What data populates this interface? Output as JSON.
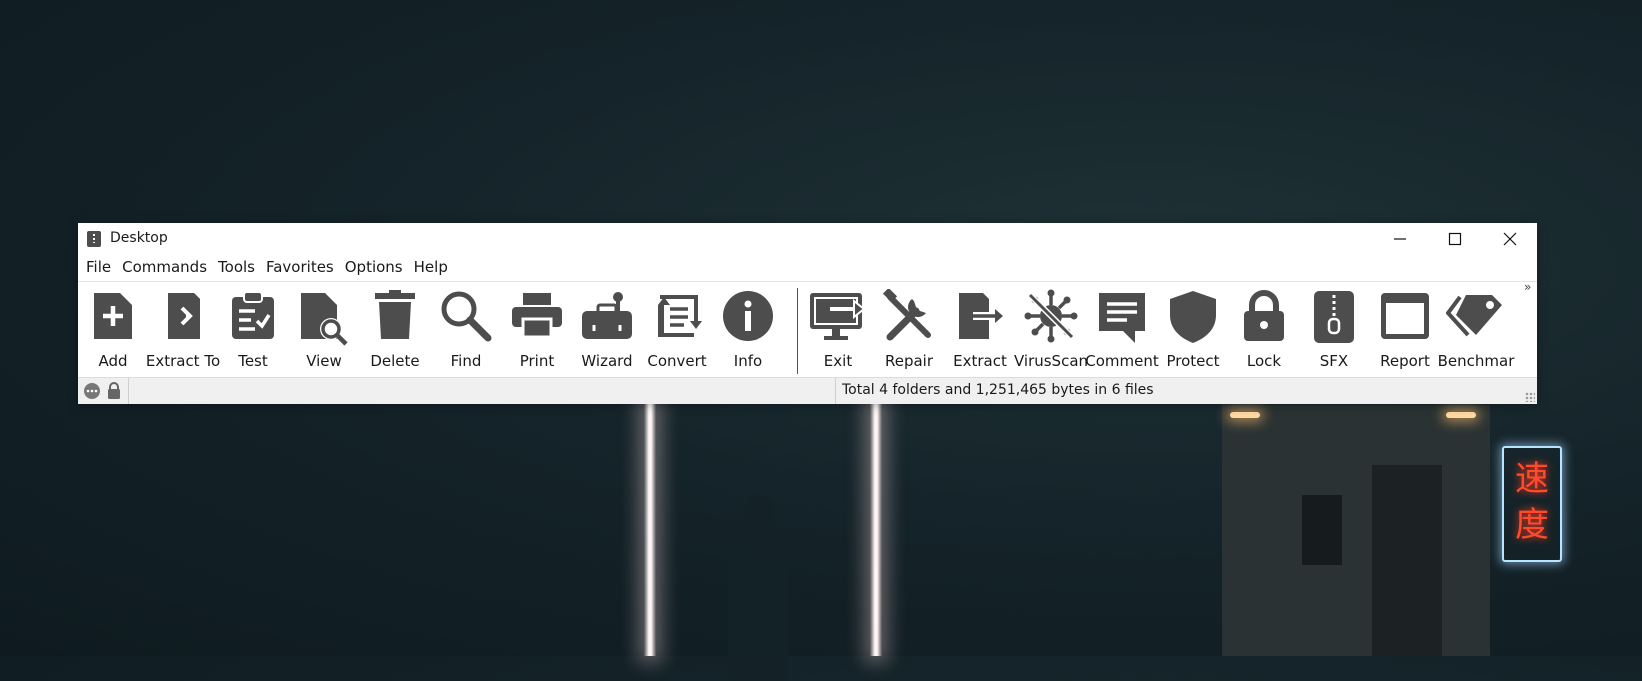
{
  "window": {
    "title": "Desktop"
  },
  "window_controls": {
    "minimize": "—",
    "maximize": "☐",
    "close": "✕"
  },
  "menu": [
    "File",
    "Commands",
    "Tools",
    "Favorites",
    "Options",
    "Help"
  ],
  "toolbar": {
    "group1": [
      {
        "label": "Add",
        "icon": "add-icon"
      },
      {
        "label": "Extract To",
        "icon": "extract-to-icon"
      },
      {
        "label": "Test",
        "icon": "test-icon"
      },
      {
        "label": "View",
        "icon": "view-icon"
      },
      {
        "label": "Delete",
        "icon": "delete-icon"
      },
      {
        "label": "Find",
        "icon": "find-icon"
      },
      {
        "label": "Print",
        "icon": "print-icon"
      },
      {
        "label": "Wizard",
        "icon": "wizard-icon"
      },
      {
        "label": "Convert",
        "icon": "convert-icon"
      },
      {
        "label": "Info",
        "icon": "info-icon"
      }
    ],
    "group2": [
      {
        "label": "Exit",
        "icon": "exit-icon"
      },
      {
        "label": "Repair",
        "icon": "repair-icon"
      },
      {
        "label": "Extract",
        "icon": "extract-icon"
      },
      {
        "label": "VirusScan",
        "icon": "virus-scan-icon"
      },
      {
        "label": "Comment",
        "icon": "comment-icon"
      },
      {
        "label": "Protect",
        "icon": "protect-icon"
      },
      {
        "label": "Lock",
        "icon": "lock-icon"
      },
      {
        "label": "SFX",
        "icon": "sfx-icon"
      },
      {
        "label": "Report",
        "icon": "report-icon"
      },
      {
        "label": "Benchmar",
        "icon": "benchmark-icon"
      }
    ],
    "overflow": "»"
  },
  "status": {
    "text": "Total 4 folders and 1,251,465 bytes in 6 files"
  },
  "background": {
    "neon_sign": "速度"
  },
  "colors": {
    "icon": "#4d4d4d",
    "window_bg": "#ffffff",
    "status_bg": "#f0f0f0"
  }
}
